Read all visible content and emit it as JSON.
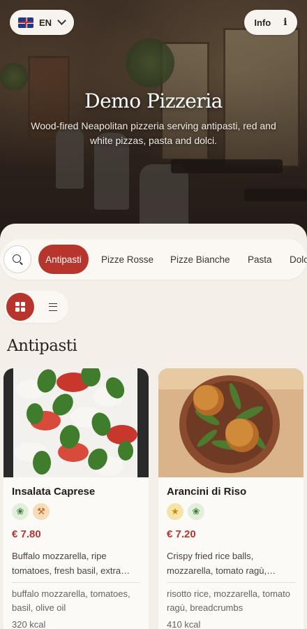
{
  "header": {
    "language": "EN",
    "info_label": "Info",
    "info_icon": "info-icon",
    "flag_icon": "uk-flag-icon"
  },
  "hero": {
    "title": "Demo Pizzeria",
    "subtitle": "Wood-fired Neapolitan pizzeria serving antipasti, red and white pizzas, pasta and dolci."
  },
  "tabs": [
    {
      "label": "Antipasti",
      "active": true
    },
    {
      "label": "Pizze Rosse",
      "active": false
    },
    {
      "label": "Pizze Bianche",
      "active": false
    },
    {
      "label": "Pasta",
      "active": false
    },
    {
      "label": "Dolci",
      "active": false
    }
  ],
  "view": {
    "mode": "grid"
  },
  "section": {
    "title": "Antipasti"
  },
  "items": [
    {
      "name": "Insalata Caprese",
      "badges": [
        "vegetarian-icon",
        "spicy-icon"
      ],
      "price": "€ 7.80",
      "description": "Buffalo mozzarella, ripe tomatoes, fresh basil, extra…",
      "ingredients": "buffalo mozzarella, tomatoes, basil, olive oil",
      "kcal": "320 kcal"
    },
    {
      "name": "Arancini di Riso",
      "badges": [
        "star-icon",
        "vegetarian-icon"
      ],
      "price": "€ 7.20",
      "description": "Crispy fried rice balls, mozzarella, tomato ragù,…",
      "ingredients": "risotto rice, mozzarella, tomato ragù, breadcrumbs",
      "kcal": "410 kcal"
    }
  ],
  "colors": {
    "accent": "#b8352d",
    "background": "#f4efe8",
    "card": "#fcfaf6"
  }
}
